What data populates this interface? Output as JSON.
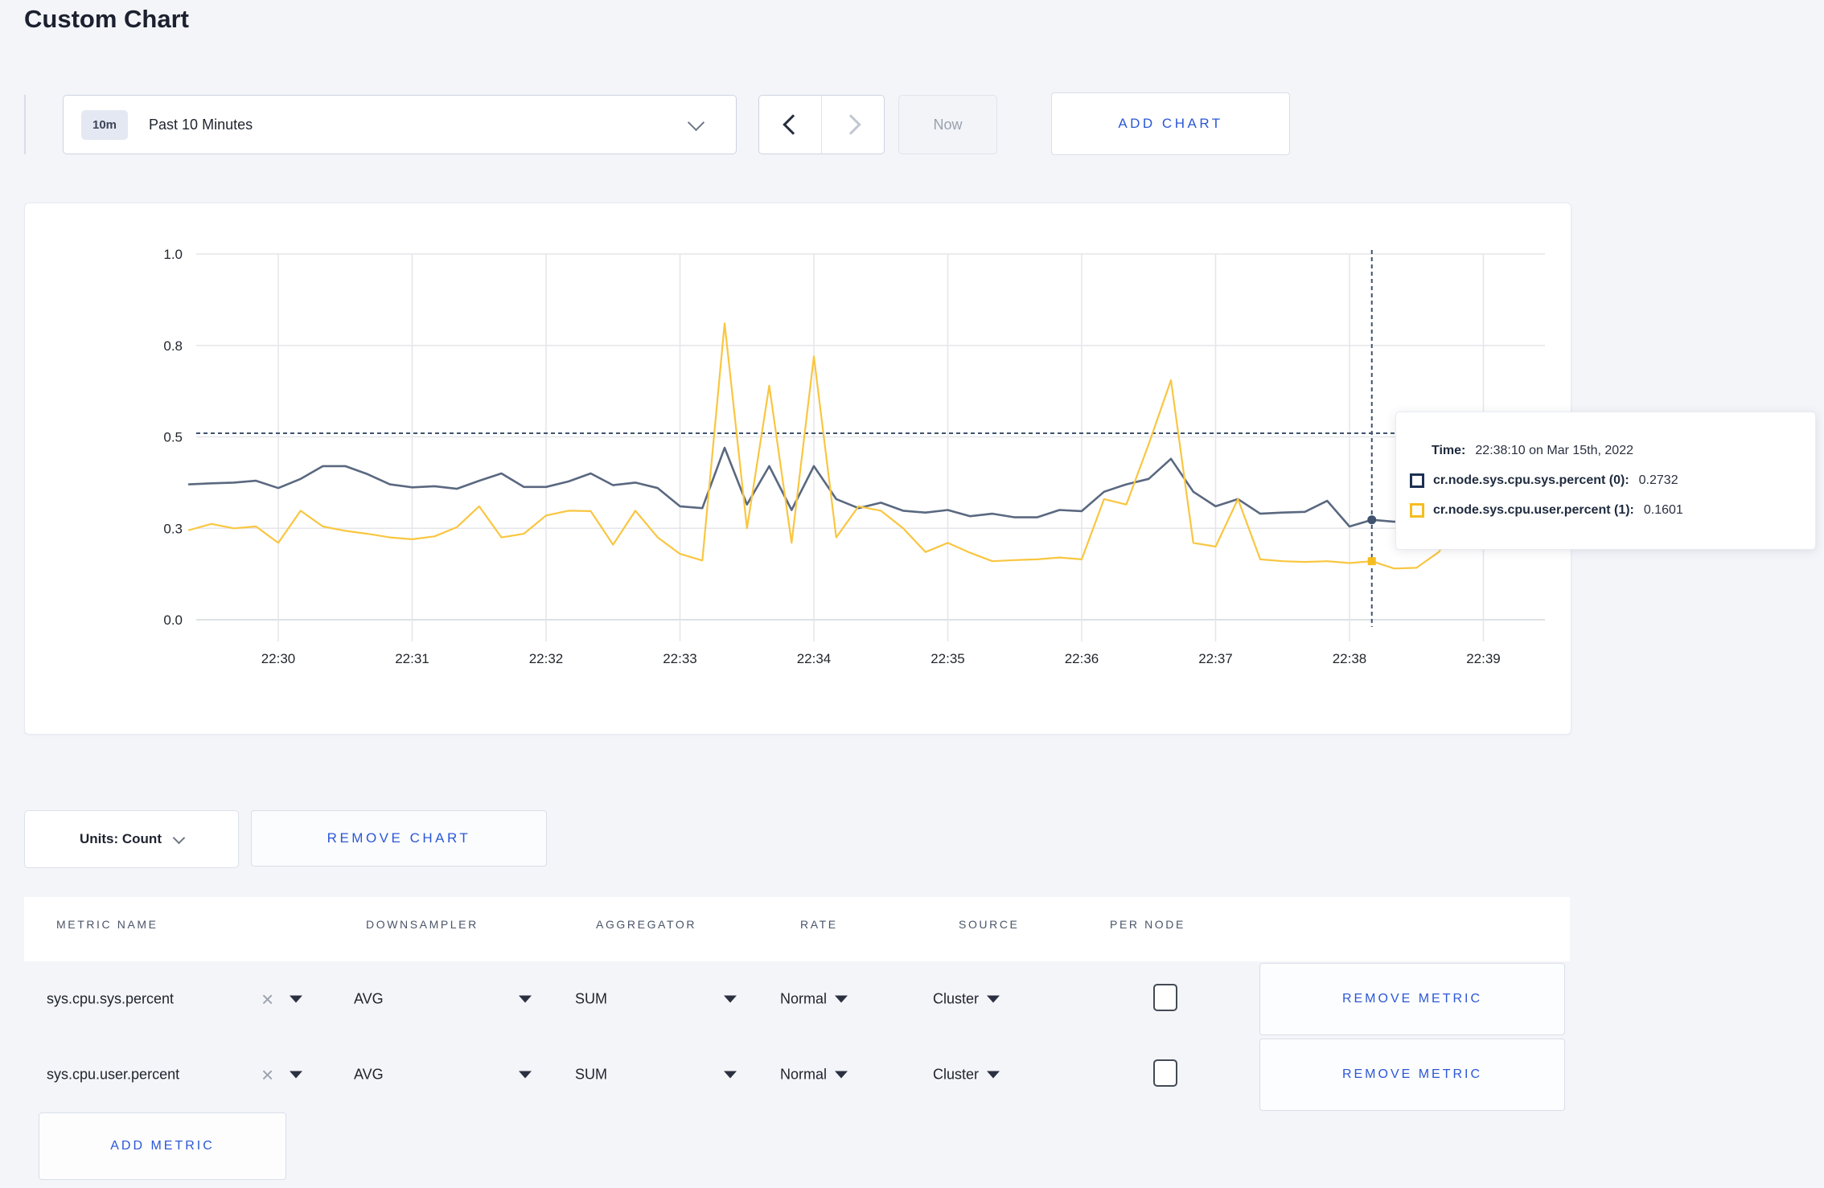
{
  "header": {
    "title": "Custom Chart"
  },
  "controls": {
    "time_range": {
      "badge": "10m",
      "label": "Past 10 Minutes"
    },
    "now_label": "Now",
    "add_chart_label": "ADD CHART"
  },
  "chart_data": {
    "type": "line",
    "title": "",
    "xlabel": "",
    "ylabel": "",
    "x_axis": {
      "ticks": [
        "22:30",
        "22:31",
        "22:32",
        "22:33",
        "22:34",
        "22:35",
        "22:36",
        "22:37",
        "22:38",
        "22:39"
      ]
    },
    "y_axis": {
      "range": [
        0,
        1
      ],
      "ticks": [
        {
          "label": "0.0",
          "value": 0
        },
        {
          "label": "0.3",
          "value": 0.25
        },
        {
          "label": "0.5",
          "value": 0.5
        },
        {
          "label": "0.8",
          "value": 0.75
        },
        {
          "label": "1.0",
          "value": 1
        }
      ]
    },
    "grid": "on",
    "start_time": "22:29:20",
    "interval_seconds": 10,
    "times": [
      "22:29:20",
      "22:29:30",
      "22:29:40",
      "22:29:50",
      "22:30:00",
      "22:30:10",
      "22:30:20",
      "22:30:30",
      "22:30:40",
      "22:30:50",
      "22:31:00",
      "22:31:10",
      "22:31:20",
      "22:31:30",
      "22:31:40",
      "22:31:50",
      "22:32:00",
      "22:32:10",
      "22:32:20",
      "22:32:30",
      "22:32:40",
      "22:32:50",
      "22:33:00",
      "22:33:10",
      "22:33:20",
      "22:33:30",
      "22:33:40",
      "22:33:50",
      "22:34:00",
      "22:34:10",
      "22:34:20",
      "22:34:30",
      "22:34:40",
      "22:34:50",
      "22:35:00",
      "22:35:10",
      "22:35:20",
      "22:35:30",
      "22:35:40",
      "22:35:50",
      "22:36:00",
      "22:36:10",
      "22:36:20",
      "22:36:30",
      "22:36:40",
      "22:36:50",
      "22:37:00",
      "22:37:10",
      "22:37:20",
      "22:37:30",
      "22:37:40",
      "22:37:50",
      "22:38:00",
      "22:38:10",
      "22:38:20",
      "22:38:30",
      "22:38:40",
      "22:38:50",
      "22:39:00",
      "22:39:10"
    ],
    "series": [
      {
        "name": "cr.node.sys.cpu.sys.percent",
        "node": "0",
        "color": "#5a6880",
        "marker_color": "#3f536f",
        "values": [
          0.37,
          0.373,
          0.375,
          0.38,
          0.36,
          0.385,
          0.42,
          0.42,
          0.398,
          0.37,
          0.362,
          0.365,
          0.358,
          0.38,
          0.4,
          0.363,
          0.363,
          0.378,
          0.4,
          0.368,
          0.375,
          0.36,
          0.31,
          0.305,
          0.47,
          0.315,
          0.42,
          0.3,
          0.42,
          0.33,
          0.305,
          0.32,
          0.298,
          0.293,
          0.3,
          0.283,
          0.29,
          0.28,
          0.28,
          0.3,
          0.297,
          0.35,
          0.37,
          0.385,
          0.44,
          0.35,
          0.31,
          0.33,
          0.29,
          0.293,
          0.295,
          0.325,
          0.255,
          0.2732,
          0.268,
          0.272,
          0.27,
          0.275,
          0.27,
          0.272
        ]
      },
      {
        "name": "cr.node.sys.cpu.user.percent",
        "node": "1",
        "color": "#f9c640",
        "marker_color": "#f5bd1f",
        "values": [
          0.245,
          0.262,
          0.25,
          0.255,
          0.21,
          0.298,
          0.255,
          0.243,
          0.235,
          0.225,
          0.22,
          0.228,
          0.253,
          0.31,
          0.225,
          0.235,
          0.285,
          0.298,
          0.297,
          0.205,
          0.298,
          0.225,
          0.18,
          0.162,
          0.81,
          0.25,
          0.64,
          0.21,
          0.72,
          0.225,
          0.31,
          0.298,
          0.25,
          0.185,
          0.21,
          0.183,
          0.16,
          0.163,
          0.165,
          0.17,
          0.165,
          0.33,
          0.315,
          0.48,
          0.655,
          0.21,
          0.2,
          0.33,
          0.165,
          0.16,
          0.158,
          0.16,
          0.155,
          0.1601,
          0.14,
          0.142,
          0.185,
          0.278,
          0.272,
          0.23
        ]
      }
    ],
    "crosshair": {
      "time": "22:38:10",
      "color": "#3f536f",
      "h_guide_value": 0.51,
      "marker_values": [
        0.2732,
        0.1601
      ]
    },
    "legend_position": "tooltip"
  },
  "tooltip": {
    "time_label": "Time:",
    "time_value": "22:38:10 on Mar 15th, 2022",
    "rows": [
      {
        "label": "cr.node.sys.cpu.sys.percent (0):",
        "value": "0.2732",
        "color": "#1c3153"
      },
      {
        "label": "cr.node.sys.cpu.user.percent (1):",
        "value": "0.1601",
        "color": "#f5bd1f"
      }
    ]
  },
  "chart_footer": {
    "units_label": "Units: Count",
    "remove_chart_label": "REMOVE CHART"
  },
  "metrics_table": {
    "headers": [
      "METRIC NAME",
      "DOWNSAMPLER",
      "AGGREGATOR",
      "RATE",
      "SOURCE",
      "PER NODE"
    ],
    "rows": [
      {
        "metric_name": "sys.cpu.sys.percent",
        "downsampler": "AVG",
        "aggregator": "SUM",
        "rate": "Normal",
        "source": "Cluster",
        "per_node_checked": false,
        "remove_label": "REMOVE METRIC"
      },
      {
        "metric_name": "sys.cpu.user.percent",
        "downsampler": "AVG",
        "aggregator": "SUM",
        "rate": "Normal",
        "source": "Cluster",
        "per_node_checked": false,
        "remove_label": "REMOVE METRIC"
      }
    ],
    "add_metric_label": "ADD METRIC"
  }
}
